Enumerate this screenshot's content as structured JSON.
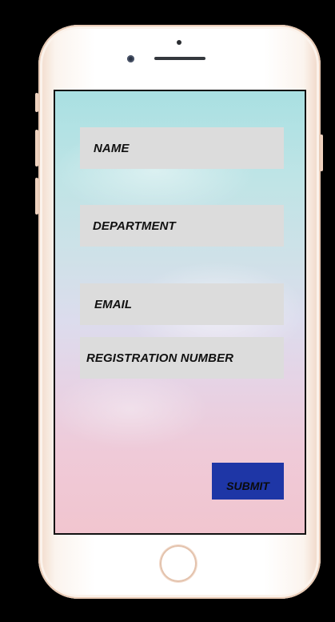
{
  "form": {
    "name_placeholder": "NAME",
    "department_placeholder": "DEPARTMENT",
    "email_placeholder": "EMAIL",
    "registration_placeholder": "REGISTRATION NUMBER",
    "submit_label": "SUBMIT"
  },
  "colors": {
    "field_background": "#dcdcdc",
    "submit_background": "#1e36a6",
    "device_frame": "#fbf4ee",
    "page_background": "#000000"
  }
}
